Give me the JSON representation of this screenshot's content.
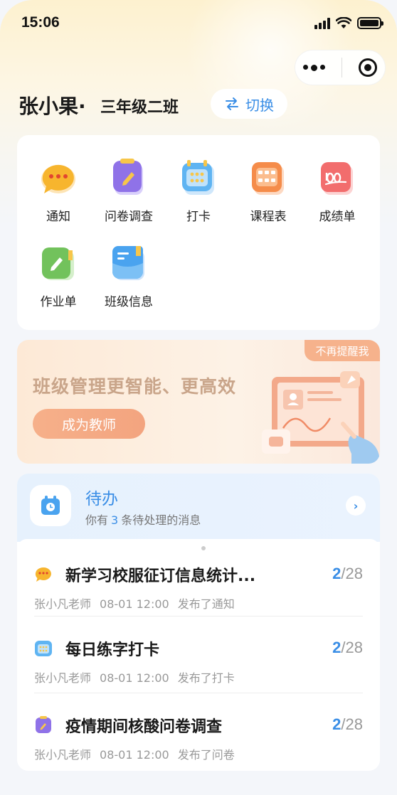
{
  "status_bar": {
    "time": "15:06"
  },
  "header": {
    "student_name": "张小果·",
    "class_name": "三年级二班",
    "switch_label": "切换"
  },
  "features": [
    {
      "label": "通知",
      "icon": "chat-bubble-icon",
      "color": "#f7b52e"
    },
    {
      "label": "问卷调查",
      "icon": "questionnaire-icon",
      "color": "#8f72e8"
    },
    {
      "label": "打卡",
      "icon": "calendar-checkin-icon",
      "color": "#5fb4f2"
    },
    {
      "label": "课程表",
      "icon": "timetable-icon",
      "color": "#f58c4a"
    },
    {
      "label": "成绩单",
      "icon": "score-100-icon",
      "color": "#f26d6d"
    },
    {
      "label": "作业单",
      "icon": "homework-notebook-icon",
      "color": "#72c25c"
    },
    {
      "label": "班级信息",
      "icon": "class-info-folder-icon",
      "color": "#4aa3ef"
    }
  ],
  "banner": {
    "dismiss_label": "不再提醒我",
    "title": "班级管理更智能、更高效",
    "cta_label": "成为教师"
  },
  "todo": {
    "title": "待办",
    "sub_prefix": "你有",
    "count": "3",
    "sub_suffix": "条待处理的消息",
    "items": [
      {
        "title": "新学习校服征订信息统计...",
        "done": "2",
        "total": "/28",
        "teacher": "张小凡老师",
        "time": "08-01 12:00",
        "action": "发布了通知",
        "icon": "chat-bubble-icon"
      },
      {
        "title": "每日练字打卡",
        "done": "2",
        "total": "/28",
        "teacher": "张小凡老师",
        "time": "08-01 12:00",
        "action": "发布了打卡",
        "icon": "calendar-checkin-icon"
      },
      {
        "title": "疫情期间核酸问卷调查",
        "done": "2",
        "total": "/28",
        "teacher": "张小凡老师",
        "time": "08-01 12:00",
        "action": "发布了问卷",
        "icon": "questionnaire-icon"
      }
    ]
  }
}
